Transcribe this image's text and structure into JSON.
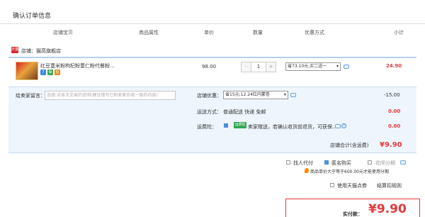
{
  "page": {
    "title": "确认订单信息"
  },
  "header": {
    "col_item": "店铺宝贝",
    "col_attr": "商品属性",
    "col_price": "单价",
    "col_qty": "数量",
    "col_promo": "优惠方式",
    "col_subtotal": "小计"
  },
  "shop": {
    "icon_text": "天猫",
    "name": "店铺：猫高旗舰店"
  },
  "item": {
    "name": "红豆薏米粉枸杞粉薏仁粉代餐粉...",
    "price": "98.00",
    "quantity": "1",
    "minus": "-",
    "plus": "+",
    "promo_selected": "省73.10元:买二送一",
    "subtotal": "24.90",
    "tags": [
      "7",
      "保",
      "信"
    ]
  },
  "details": {
    "memo_label": "给卖家留言：",
    "memo_placeholder": "选填:对本次交易的说明(建议填写已和卖家协商一致的内容)",
    "shop_promo_label": "店铺优惠：",
    "shop_promo_selected": "省15元:12.24红内蒙卷",
    "shop_promo_value": "-15.00",
    "shipping_label": "运送方式：",
    "shipping_value": "普通配送 快递 免邮",
    "shipping_cost": "0.00",
    "insurance_label": "运费险：",
    "insurance_badge": "运费险",
    "insurance_text": "卖家赠送，若确认收货前退货，可获保...",
    "insurance_cost": "0.00",
    "total_label": "店铺合计(含运费)",
    "total_value": "¥9.90"
  },
  "options": {
    "proxy_pay": "找人代付",
    "anonymous": "匿名购买",
    "installment": "花呗分期",
    "notice": "商品单价大于等于600.00元才能使用分期",
    "tmall_points": "使用天猫点券",
    "points_rule": "结算扣规则"
  },
  "payment": {
    "label": "实付款：",
    "amount": "¥9.90"
  },
  "colors": {
    "accent": "#e4393c",
    "blue": "#4a8fe0",
    "detail_bg": "#eef5fc"
  }
}
